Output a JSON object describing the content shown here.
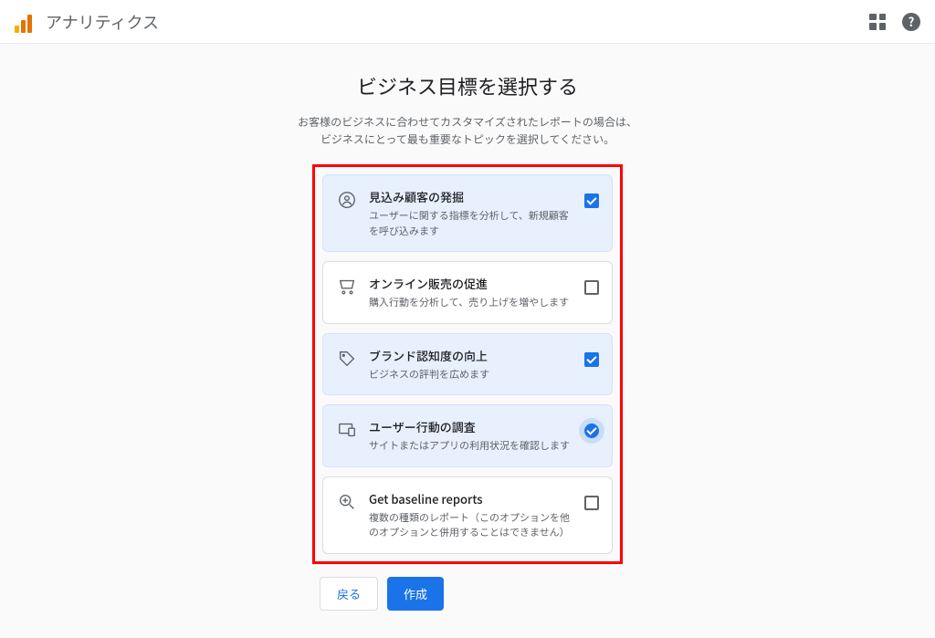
{
  "header": {
    "title": "アナリティクス"
  },
  "page": {
    "title": "ビジネス目標を選択する",
    "subtitle_line1": "お客様のビジネスに合わせてカスタマイズされたレポートの場合は、",
    "subtitle_line2": "ビジネスにとって最も重要なトピックを選択してください。"
  },
  "options": [
    {
      "title": "見込み顧客の発掘",
      "desc": "ユーザーに関する指標を分析して、新規顧客を呼び込みます",
      "selected": true,
      "icon": "target-user"
    },
    {
      "title": "オンライン販売の促進",
      "desc": "購入行動を分析して、売り上げを増やします",
      "selected": false,
      "icon": "cart"
    },
    {
      "title": "ブランド認知度の向上",
      "desc": "ビジネスの評判を広めます",
      "selected": true,
      "icon": "tag"
    },
    {
      "title": "ユーザー行動の調査",
      "desc": "サイトまたはアプリの利用状況を確認します",
      "selected": true,
      "icon": "devices"
    },
    {
      "title": "Get baseline reports",
      "desc": "複数の種類のレポート（このオプションを他のオプションと併用することはできません）",
      "selected": false,
      "icon": "insights"
    }
  ],
  "buttons": {
    "back": "戻る",
    "create": "作成"
  }
}
